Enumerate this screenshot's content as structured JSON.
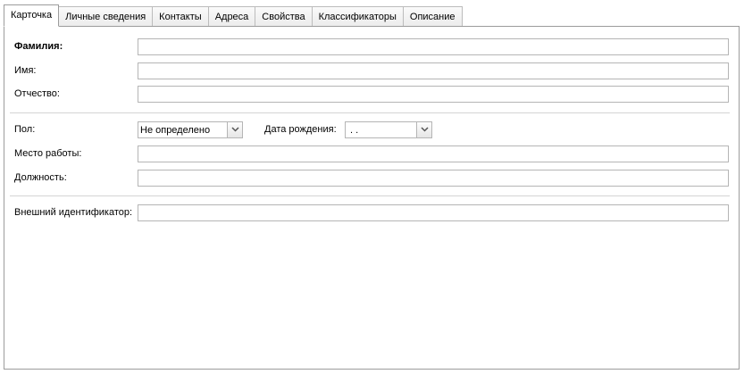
{
  "tabs": [
    {
      "label": "Карточка",
      "active": true
    },
    {
      "label": "Личные сведения",
      "active": false
    },
    {
      "label": "Контакты",
      "active": false
    },
    {
      "label": "Адреса",
      "active": false
    },
    {
      "label": "Свойства",
      "active": false
    },
    {
      "label": "Классификаторы",
      "active": false
    },
    {
      "label": "Описание",
      "active": false
    }
  ],
  "form": {
    "last_name_label": "Фамилия:",
    "last_name_value": "",
    "first_name_label": "Имя:",
    "first_name_value": "",
    "middle_name_label": "Отчество:",
    "middle_name_value": "",
    "gender_label": "Пол:",
    "gender_value": "Не определено",
    "birth_date_label": "Дата рождения:",
    "birth_date_value": " .  .",
    "workplace_label": "Место работы:",
    "workplace_value": "",
    "position_label": "Должность:",
    "position_value": "",
    "external_id_label": "Внешний идентификатор:",
    "external_id_value": ""
  },
  "icons": {
    "dropdown": "chevron-down-icon"
  }
}
